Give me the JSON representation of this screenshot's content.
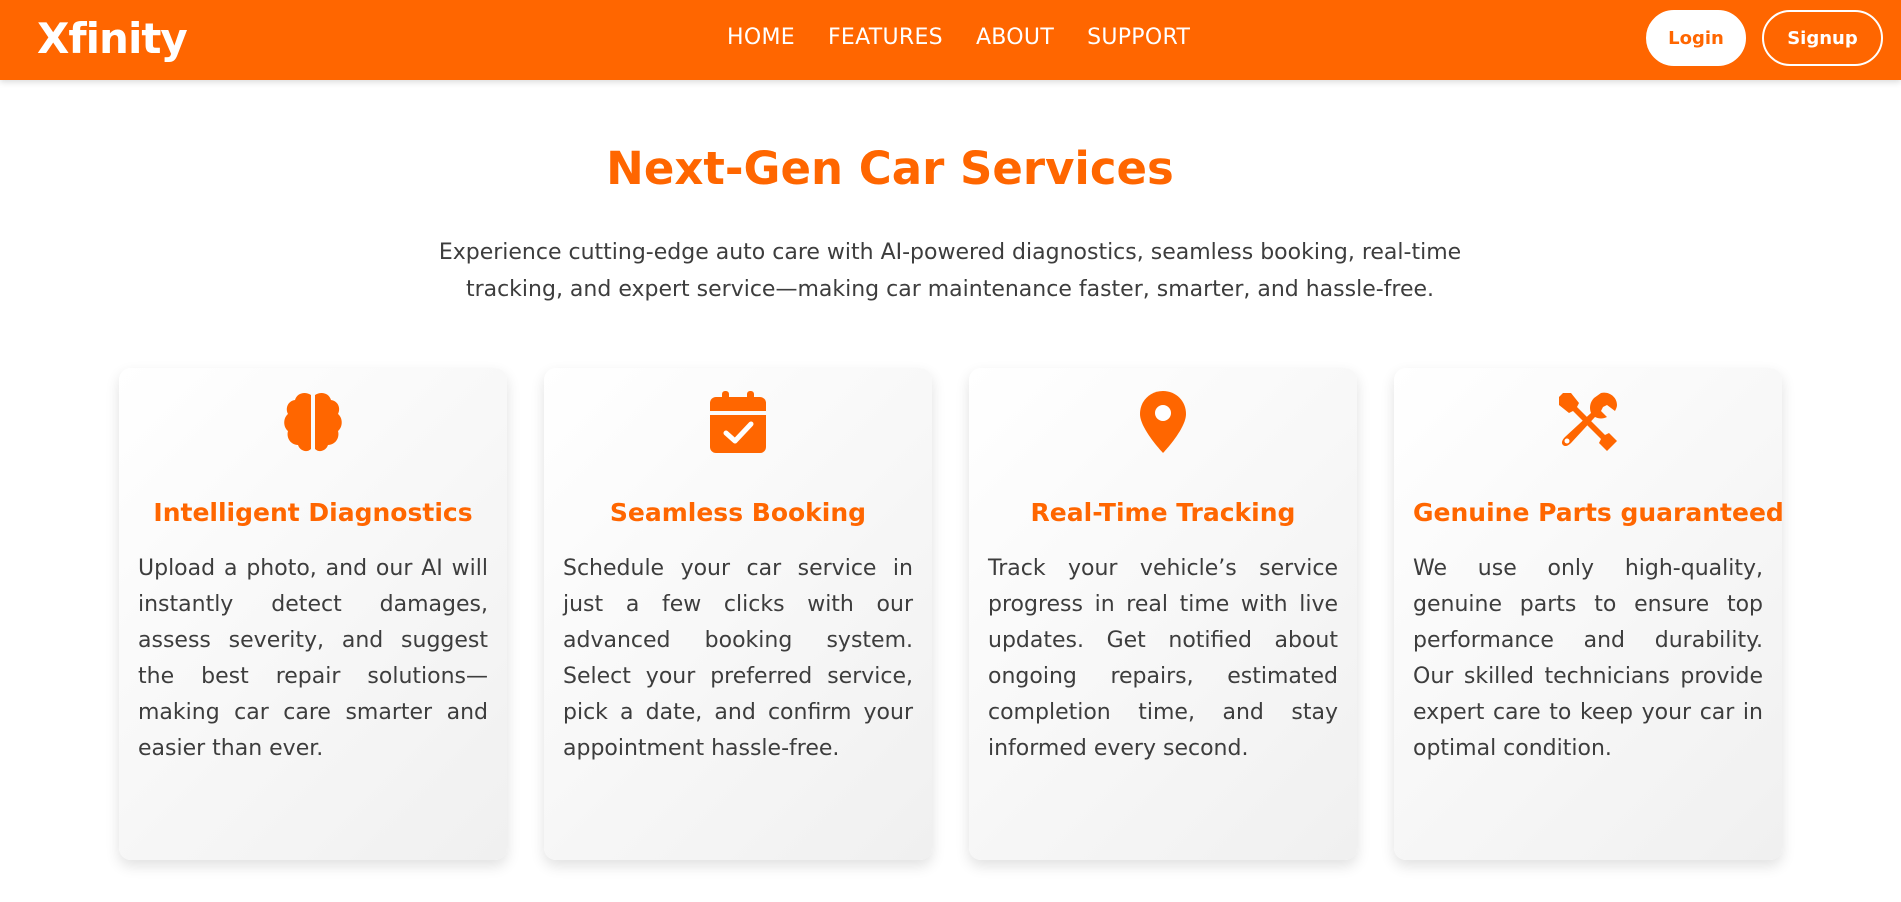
{
  "brand": {
    "logo": "Xfinity",
    "accent": "#ff6600"
  },
  "nav": {
    "items": [
      {
        "label": "HOME"
      },
      {
        "label": "FEATURES"
      },
      {
        "label": "ABOUT"
      },
      {
        "label": "SUPPORT"
      }
    ],
    "login_label": "Login",
    "signup_label": "Signup"
  },
  "hero": {
    "title": "Next-Gen Car Services",
    "subtitle": "Experience cutting-edge auto care with AI-powered diagnostics, seamless booking, real-time tracking, and expert service—making car maintenance faster, smarter, and hassle-free."
  },
  "cards": [
    {
      "icon": "brain-icon",
      "title": "Intelligent Diagnostics",
      "text": "Upload a photo, and our AI will instantly detect damages, assess severity, and suggest the best repair solutions—making car care smarter and easier than ever."
    },
    {
      "icon": "calendar-check-icon",
      "title": "Seamless Booking",
      "text": "Schedule your car service in just a few clicks with our advanced booking system. Select your preferred service, pick a date, and confirm your appointment hassle-free."
    },
    {
      "icon": "location-pin-icon",
      "title": "Real-Time Tracking",
      "text": "Track your vehicle’s service progress in real time with live updates. Get notified about ongoing repairs, estimated completion time, and stay informed every second."
    },
    {
      "icon": "tools-icon",
      "title": "Genuine Parts guaranteed",
      "text": "We use only high-quality, genuine parts to ensure top performance and durability. Our skilled technicians provide expert care to keep your car in optimal condition."
    }
  ]
}
